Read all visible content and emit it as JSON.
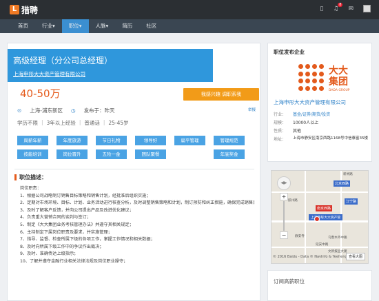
{
  "header": {
    "logo_mark": "L",
    "logo_text": "猎聘",
    "icons": [
      "phone-icon",
      "bell-icon",
      "message-icon",
      "avatar"
    ],
    "notification_count": "8"
  },
  "nav": {
    "items": [
      {
        "label": "首页",
        "active": false
      },
      {
        "label": "行业▾",
        "active": false
      },
      {
        "label": "职位▾",
        "active": true
      },
      {
        "label": "人脉▾",
        "active": false
      },
      {
        "label": "简历",
        "active": false
      },
      {
        "label": "社区",
        "active": false
      }
    ]
  },
  "job": {
    "title": "高级经理（分公司总经理）",
    "company": "上海申彤大大资产管理有限公司",
    "salary": "40-50万",
    "apply_label": "我感兴趣 调职系我",
    "report": "举报",
    "location": "上海-浦东新区",
    "published": "发布于：昨天",
    "age": "25-45岁",
    "education": "学历不限",
    "experience": "3年以上经验",
    "language": "普通话",
    "tags": [
      "周薪年薪",
      "年度旅游",
      "节日礼物",
      "领导好",
      "扁平管理",
      "管理规范",
      "技能培训",
      "岗位晋升",
      "五险一金",
      "团队聚餐",
      "",
      "年底奖金"
    ]
  },
  "description": {
    "title": "职位描述：",
    "lines": [
      "岗位职责：",
      "1、根据公司战略制订销售目标策略和销售计划，经批准后组织实施；",
      "2、定期对市场环境、目标、计划、业务活动进行核查分析，及时调整销售策略和计划，制订预防和纠正措施，确保完成销售目标和销售计划；",
      "3、及时了解客户反馈，并向公司提出产品及改进优化建议；",
      "4、负责重大营销合同的谈判与签订；",
      "5、制定《大大集团业务考核管理办法》并遵守其相关规定；",
      "6、主持制定下属岗位职责及要求，并实施管理；",
      "7、指导、监督、检查所属下级的各项工作，掌握工作情况和相关数据；",
      "8、及时向所属下级工作中的争议作出裁决；",
      "9、及时、准确传达上级指示；",
      "10、了解并遵守金融行业相关法律法规及岗位职业操守；"
    ]
  },
  "sidebar": {
    "publisher_title": "职位发布企业",
    "logo_cn": "大大集团",
    "logo_en": "DADA GROUP",
    "company": "上海申彤大大资产管理有限公司",
    "info": [
      {
        "key": "行业：",
        "value": "基金/证券/期货/投资",
        "link": true
      },
      {
        "key": "规模：",
        "value": "10000人以上",
        "link": false
      },
      {
        "key": "性质：",
        "value": "其他",
        "link": false
      },
      {
        "key": "地址：",
        "value": "上海市静安区南京西路1168号中信泰富35楼",
        "link": false
      }
    ],
    "subscribe_title": "订阅高薪职位"
  },
  "map": {
    "stations": [
      "北京西路",
      "南京西路",
      "江宁路"
    ],
    "marker_label": "上海申彤大大资产管",
    "places": [
      "新闸路",
      "静安寺",
      "乌鲁木齐中路",
      "胶州路",
      "延安中路",
      "文新报业大厦"
    ],
    "copyright": "© 2016 Baidu - Data © NavInfo & Yeeheng",
    "big_map": "查看大图",
    "pan": "◀▶",
    "zoom_in": "+",
    "zoom_out": "−"
  }
}
